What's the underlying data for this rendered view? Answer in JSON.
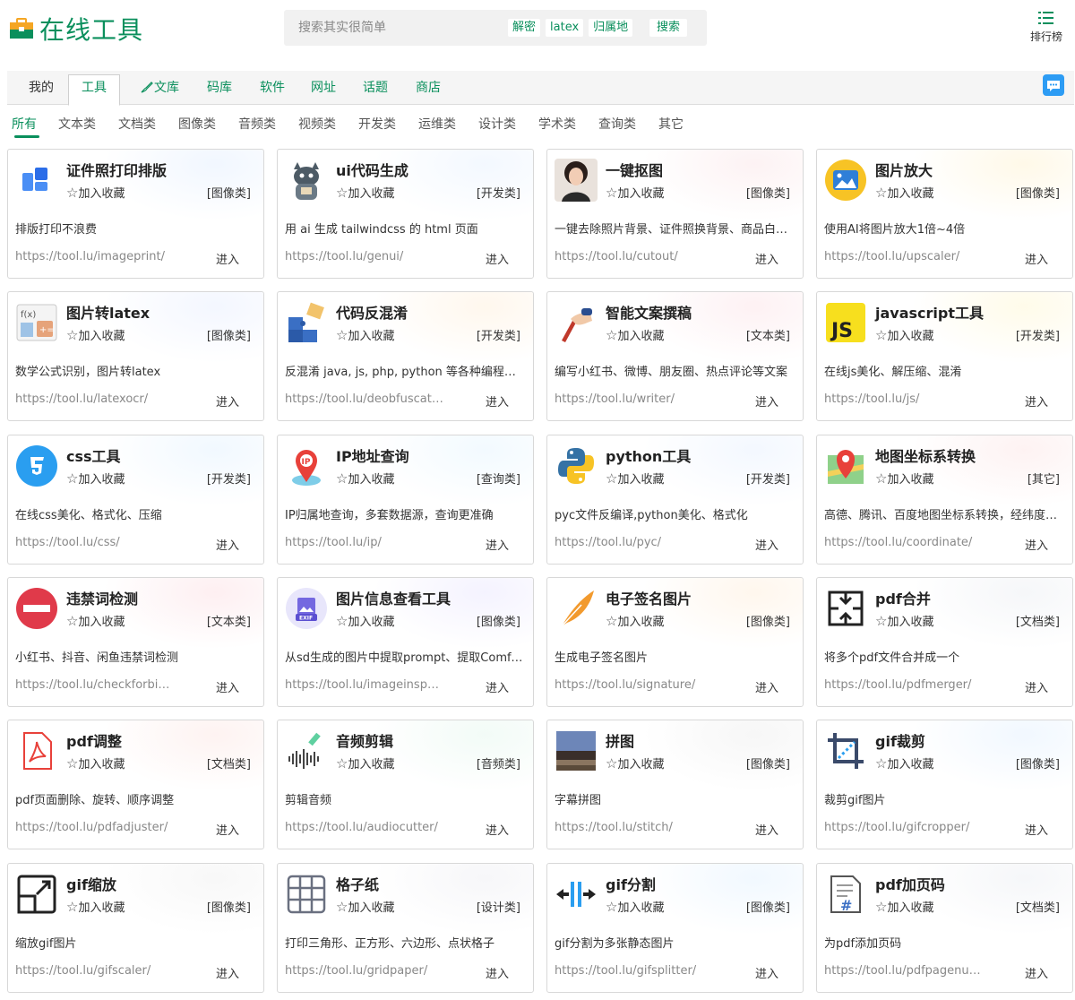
{
  "brand": {
    "name": "在线工具",
    "accent": "#0a8f5c"
  },
  "search": {
    "placeholder": "搜索其实很简单",
    "hot_tags": [
      "解密",
      "latex",
      "归属地"
    ],
    "button": "搜索"
  },
  "ranking": {
    "label": "排行榜",
    "icon": "list-icon"
  },
  "nav": {
    "tabs": [
      "我的",
      "工具",
      "文库",
      "码库",
      "软件",
      "网址",
      "话题",
      "商店"
    ],
    "active": "工具"
  },
  "subnav": {
    "items": [
      "所有",
      "文本类",
      "文档类",
      "图像类",
      "音频类",
      "视频类",
      "开发类",
      "运维类",
      "设计类",
      "学术类",
      "查询类",
      "其它"
    ],
    "active": "所有"
  },
  "fav_label": "加入收藏",
  "enter_label": "进入",
  "tools": [
    {
      "title": "证件照打印排版",
      "category": "[图像类]",
      "desc": "排版打印不浪费",
      "url": "https://tool.lu/imageprint/",
      "icon": "blue-squares-icon"
    },
    {
      "title": "ui代码生成",
      "category": "[开发类]",
      "desc": "用 ai 生成 tailwindcss 的 html 页面",
      "url": "https://tool.lu/genui/",
      "icon": "cat-mascot-icon"
    },
    {
      "title": "一键抠图",
      "category": "[图像类]",
      "desc": "一键去除照片背景、证件照换背景、商品白底图",
      "url": "https://tool.lu/cutout/",
      "icon": "portrait-icon"
    },
    {
      "title": "图片放大",
      "category": "[图像类]",
      "desc": "使用AI将图片放大1倍~4倍",
      "url": "https://tool.lu/upscaler/",
      "icon": "image-upscale-icon"
    },
    {
      "title": "图片转latex",
      "category": "[图像类]",
      "desc": "数学公式识别，图片转latex",
      "url": "https://tool.lu/latexocr/",
      "icon": "formula-icon"
    },
    {
      "title": "代码反混淆",
      "category": "[开发类]",
      "desc": "反混淆 java, js, php, python 等各种编程语言",
      "url": "https://tool.lu/deobfuscation/",
      "icon": "puzzle-icon"
    },
    {
      "title": "智能文案撰稿",
      "category": "[文本类]",
      "desc": "编写小红书、微博、朋友圈、热点评论等文案",
      "url": "https://tool.lu/writer/",
      "icon": "writing-hand-icon"
    },
    {
      "title": "javascript工具",
      "category": "[开发类]",
      "desc": "在线js美化、解压缩、混淆",
      "url": "https://tool.lu/js/",
      "icon": "js-icon"
    },
    {
      "title": "css工具",
      "category": "[开发类]",
      "desc": "在线css美化、格式化、压缩",
      "url": "https://tool.lu/css/",
      "icon": "css3-icon"
    },
    {
      "title": "IP地址查询",
      "category": "[查询类]",
      "desc": "IP归属地查询，多套数据源，查询更准确",
      "url": "https://tool.lu/ip/",
      "icon": "ip-pin-icon"
    },
    {
      "title": "python工具",
      "category": "[开发类]",
      "desc": "pyc文件反编译,python美化、格式化",
      "url": "https://tool.lu/pyc/",
      "icon": "python-icon"
    },
    {
      "title": "地图坐标系转换",
      "category": "[其它]",
      "desc": "高德、腾讯、百度地图坐标系转换，经纬度转换",
      "url": "https://tool.lu/coordinate/",
      "icon": "map-pin-icon"
    },
    {
      "title": "违禁词检测",
      "category": "[文本类]",
      "desc": "小红书、抖音、闲鱼违禁词检测",
      "url": "https://tool.lu/checkforbidden/",
      "icon": "forbidden-icon"
    },
    {
      "title": "图片信息查看工具",
      "category": "[图像类]",
      "desc": "从sd生成的图片中提取prompt、提取ComfyUI工作流",
      "url": "https://tool.lu/imageinspector/",
      "icon": "exif-icon"
    },
    {
      "title": "电子签名图片",
      "category": "[图像类]",
      "desc": "生成电子签名图片",
      "url": "https://tool.lu/signature/",
      "icon": "feather-icon"
    },
    {
      "title": "pdf合并",
      "category": "[文档类]",
      "desc": "将多个pdf文件合并成一个",
      "url": "https://tool.lu/pdfmerger/",
      "icon": "merge-icon"
    },
    {
      "title": "pdf调整",
      "category": "[文档类]",
      "desc": "pdf页面删除、旋转、顺序调整",
      "url": "https://tool.lu/pdfadjuster/",
      "icon": "pdf-icon"
    },
    {
      "title": "音频剪辑",
      "category": "[音频类]",
      "desc": "剪辑音频",
      "url": "https://tool.lu/audiocutter/",
      "icon": "waveform-icon"
    },
    {
      "title": "拼图",
      "category": "[图像类]",
      "desc": "字幕拼图",
      "url": "https://tool.lu/stitch/",
      "icon": "photo-stitch-icon"
    },
    {
      "title": "gif裁剪",
      "category": "[图像类]",
      "desc": "裁剪gif图片",
      "url": "https://tool.lu/gifcropper/",
      "icon": "crop-icon"
    },
    {
      "title": "gif缩放",
      "category": "[图像类]",
      "desc": "缩放gif图片",
      "url": "https://tool.lu/gifscaler/",
      "icon": "resize-icon"
    },
    {
      "title": "格子纸",
      "category": "[设计类]",
      "desc": "打印三角形、正方形、六边形、点状格子",
      "url": "https://tool.lu/gridpaper/",
      "icon": "grid-icon"
    },
    {
      "title": "gif分割",
      "category": "[图像类]",
      "desc": "gif分割为多张静态图片",
      "url": "https://tool.lu/gifsplitter/",
      "icon": "split-icon"
    },
    {
      "title": "pdf加页码",
      "category": "[文档类]",
      "desc": "为pdf添加页码",
      "url": "https://tool.lu/pdfpagenum/",
      "icon": "page-number-icon"
    }
  ]
}
